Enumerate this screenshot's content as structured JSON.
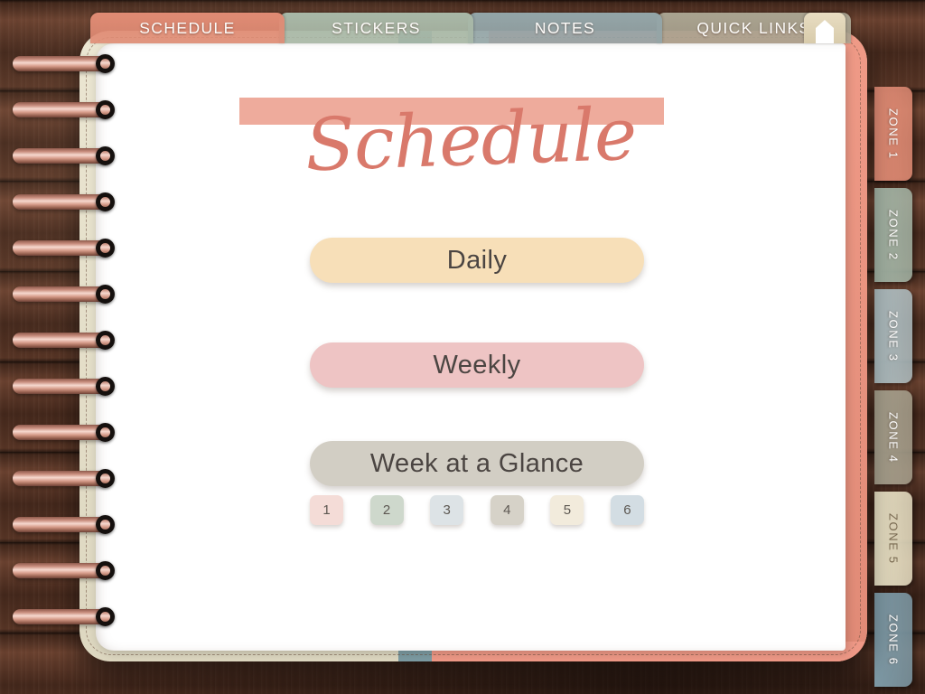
{
  "top_tabs": [
    {
      "label": "SCHEDULE",
      "color": "#e08b74",
      "name": "tab-schedule"
    },
    {
      "label": "STICKERS",
      "color": "#a8b8a7",
      "name": "tab-stickers"
    },
    {
      "label": "NOTES",
      "color": "#93a5a8",
      "name": "tab-notes"
    },
    {
      "label": "QUICK LINKS",
      "color": "#a9a390",
      "name": "tab-quick-links"
    }
  ],
  "home_tab": {
    "icon": "home-icon",
    "color": "#e2d7ba"
  },
  "page": {
    "title": "Schedule",
    "title_color": "#d9796b",
    "highlight_color": "#eeab9c",
    "buttons": [
      {
        "label": "Daily",
        "color": "#f7dfb8",
        "name": "daily-button"
      },
      {
        "label": "Weekly",
        "color": "#eec4c4",
        "name": "weekly-button"
      },
      {
        "label": "Week at a Glance",
        "color": "#d2cec4",
        "name": "week-at-a-glance-button"
      }
    ],
    "chips": [
      {
        "label": "1",
        "color": "#f4dcd7"
      },
      {
        "label": "2",
        "color": "#ced8cc"
      },
      {
        "label": "3",
        "color": "#dde3e6"
      },
      {
        "label": "4",
        "color": "#d6d2c8"
      },
      {
        "label": "5",
        "color": "#f2ebdc"
      },
      {
        "label": "6",
        "color": "#d3dde3"
      }
    ]
  },
  "zone_tabs": [
    {
      "label": "ZONE 1",
      "color": "#e08b74",
      "dark_label": false
    },
    {
      "label": "ZONE 2",
      "color": "#a3b3a4",
      "dark_label": false
    },
    {
      "label": "ZONE 3",
      "color": "#adbcbf",
      "dark_label": false
    },
    {
      "label": "ZONE 4",
      "color": "#a69f8c",
      "dark_label": false
    },
    {
      "label": "ZONE 5",
      "color": "#e7dfc3",
      "dark_label": true
    },
    {
      "label": "ZONE 6",
      "color": "#7e9aa6",
      "dark_label": false
    }
  ],
  "cover": {
    "cream_color": "#e6e0ca",
    "coral_color": "#ee9886",
    "teal_color": "#7c9ba2"
  },
  "spiral": {
    "ring_count": 13
  }
}
